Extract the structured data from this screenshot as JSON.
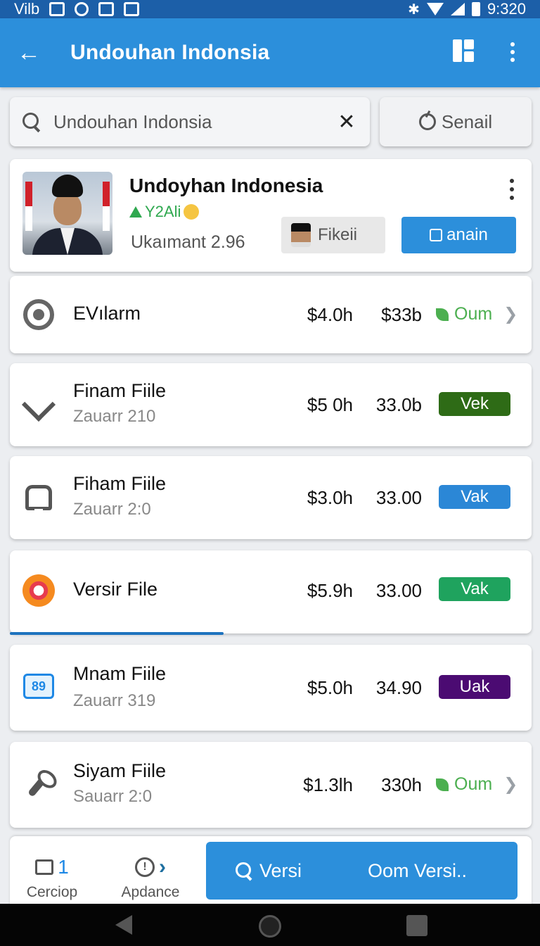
{
  "status_bar": {
    "carrier": "Vilb",
    "time": "9:320"
  },
  "app_bar": {
    "title": "Undouhan Indonsia"
  },
  "search": {
    "value": "Undouhan Indonsia",
    "send_label": "Senail"
  },
  "profile": {
    "name": "Undoyhan Indonesia",
    "tag": "Y2Ali",
    "subtitle": "Ukaımant 2.96",
    "chip_label": "Fikeii",
    "login_label": "anain"
  },
  "rows": [
    {
      "title": "EVılarm",
      "subtitle": "",
      "value1": "$4.0h",
      "value2": "$33b",
      "status": "Oum",
      "status_type": "link",
      "icon": "record-icon"
    },
    {
      "title": "Finam Fiile",
      "subtitle": "Zauarr 210",
      "value1": "$5 0h",
      "value2": "33.0b",
      "status": "Vek",
      "status_type": "badge",
      "color": "#2e6b16",
      "icon": "share-arrow-icon"
    },
    {
      "title": "Fiham Fiile",
      "subtitle": "Zauarr 2:0",
      "value1": "$3.0h",
      "value2": "33.00",
      "status": "Vak",
      "status_type": "badge",
      "color": "#2b87d6",
      "icon": "bus-icon"
    },
    {
      "title": "Versir File",
      "subtitle": "",
      "value1": "$5.9h",
      "value2": "33.00",
      "status": "Vak",
      "status_type": "badge",
      "color": "#1fa35e",
      "icon": "target-icon",
      "progress": 0.41
    },
    {
      "title": "Mnam Fiile",
      "subtitle": "Zauarr 319",
      "value1": "$5.0h",
      "value2": "34.90",
      "status": "Uak",
      "status_type": "badge",
      "color": "#4b0b72",
      "icon": "calendar-icon"
    },
    {
      "title": "Siyam Fiile",
      "subtitle": "Sauarr 2:0",
      "value1": "$1.3lh",
      "value2": "330h",
      "status": "Oum",
      "status_type": "link",
      "icon": "wrench-icon"
    }
  ],
  "bottom_nav": {
    "item1": {
      "label": "Cerciop",
      "count": "1"
    },
    "item2": {
      "label": "Apdance"
    },
    "primary": {
      "search_label": "Versi",
      "action_label": "Oom Versi.."
    }
  },
  "colors": {
    "accent": "#2c8fdb",
    "status_bar": "#1c5fa8",
    "oum_green": "#4caf50"
  }
}
